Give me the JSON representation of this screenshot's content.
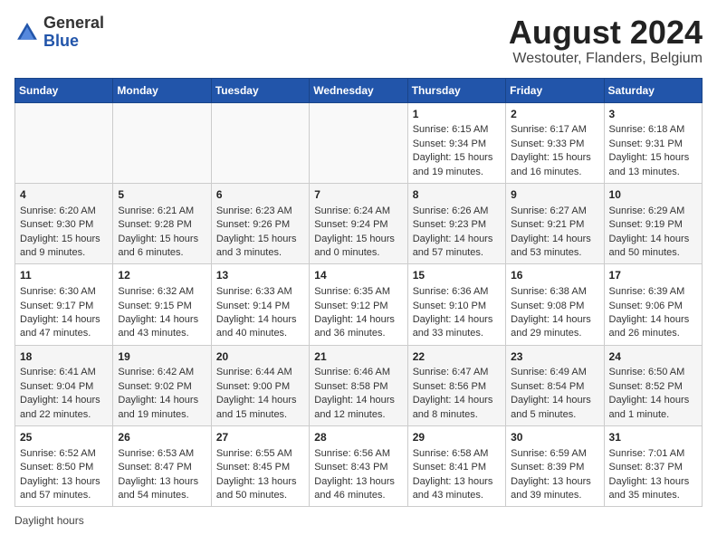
{
  "logo": {
    "general": "General",
    "blue": "Blue"
  },
  "title": "August 2024",
  "subtitle": "Westouter, Flanders, Belgium",
  "days_of_week": [
    "Sunday",
    "Monday",
    "Tuesday",
    "Wednesday",
    "Thursday",
    "Friday",
    "Saturday"
  ],
  "footer": "Daylight hours",
  "weeks": [
    [
      {
        "day": "",
        "content": ""
      },
      {
        "day": "",
        "content": ""
      },
      {
        "day": "",
        "content": ""
      },
      {
        "day": "",
        "content": ""
      },
      {
        "day": "1",
        "content": "Sunrise: 6:15 AM\nSunset: 9:34 PM\nDaylight: 15 hours\nand 19 minutes."
      },
      {
        "day": "2",
        "content": "Sunrise: 6:17 AM\nSunset: 9:33 PM\nDaylight: 15 hours\nand 16 minutes."
      },
      {
        "day": "3",
        "content": "Sunrise: 6:18 AM\nSunset: 9:31 PM\nDaylight: 15 hours\nand 13 minutes."
      }
    ],
    [
      {
        "day": "4",
        "content": "Sunrise: 6:20 AM\nSunset: 9:30 PM\nDaylight: 15 hours\nand 9 minutes."
      },
      {
        "day": "5",
        "content": "Sunrise: 6:21 AM\nSunset: 9:28 PM\nDaylight: 15 hours\nand 6 minutes."
      },
      {
        "day": "6",
        "content": "Sunrise: 6:23 AM\nSunset: 9:26 PM\nDaylight: 15 hours\nand 3 minutes."
      },
      {
        "day": "7",
        "content": "Sunrise: 6:24 AM\nSunset: 9:24 PM\nDaylight: 15 hours\nand 0 minutes."
      },
      {
        "day": "8",
        "content": "Sunrise: 6:26 AM\nSunset: 9:23 PM\nDaylight: 14 hours\nand 57 minutes."
      },
      {
        "day": "9",
        "content": "Sunrise: 6:27 AM\nSunset: 9:21 PM\nDaylight: 14 hours\nand 53 minutes."
      },
      {
        "day": "10",
        "content": "Sunrise: 6:29 AM\nSunset: 9:19 PM\nDaylight: 14 hours\nand 50 minutes."
      }
    ],
    [
      {
        "day": "11",
        "content": "Sunrise: 6:30 AM\nSunset: 9:17 PM\nDaylight: 14 hours\nand 47 minutes."
      },
      {
        "day": "12",
        "content": "Sunrise: 6:32 AM\nSunset: 9:15 PM\nDaylight: 14 hours\nand 43 minutes."
      },
      {
        "day": "13",
        "content": "Sunrise: 6:33 AM\nSunset: 9:14 PM\nDaylight: 14 hours\nand 40 minutes."
      },
      {
        "day": "14",
        "content": "Sunrise: 6:35 AM\nSunset: 9:12 PM\nDaylight: 14 hours\nand 36 minutes."
      },
      {
        "day": "15",
        "content": "Sunrise: 6:36 AM\nSunset: 9:10 PM\nDaylight: 14 hours\nand 33 minutes."
      },
      {
        "day": "16",
        "content": "Sunrise: 6:38 AM\nSunset: 9:08 PM\nDaylight: 14 hours\nand 29 minutes."
      },
      {
        "day": "17",
        "content": "Sunrise: 6:39 AM\nSunset: 9:06 PM\nDaylight: 14 hours\nand 26 minutes."
      }
    ],
    [
      {
        "day": "18",
        "content": "Sunrise: 6:41 AM\nSunset: 9:04 PM\nDaylight: 14 hours\nand 22 minutes."
      },
      {
        "day": "19",
        "content": "Sunrise: 6:42 AM\nSunset: 9:02 PM\nDaylight: 14 hours\nand 19 minutes."
      },
      {
        "day": "20",
        "content": "Sunrise: 6:44 AM\nSunset: 9:00 PM\nDaylight: 14 hours\nand 15 minutes."
      },
      {
        "day": "21",
        "content": "Sunrise: 6:46 AM\nSunset: 8:58 PM\nDaylight: 14 hours\nand 12 minutes."
      },
      {
        "day": "22",
        "content": "Sunrise: 6:47 AM\nSunset: 8:56 PM\nDaylight: 14 hours\nand 8 minutes."
      },
      {
        "day": "23",
        "content": "Sunrise: 6:49 AM\nSunset: 8:54 PM\nDaylight: 14 hours\nand 5 minutes."
      },
      {
        "day": "24",
        "content": "Sunrise: 6:50 AM\nSunset: 8:52 PM\nDaylight: 14 hours\nand 1 minute."
      }
    ],
    [
      {
        "day": "25",
        "content": "Sunrise: 6:52 AM\nSunset: 8:50 PM\nDaylight: 13 hours\nand 57 minutes."
      },
      {
        "day": "26",
        "content": "Sunrise: 6:53 AM\nSunset: 8:47 PM\nDaylight: 13 hours\nand 54 minutes."
      },
      {
        "day": "27",
        "content": "Sunrise: 6:55 AM\nSunset: 8:45 PM\nDaylight: 13 hours\nand 50 minutes."
      },
      {
        "day": "28",
        "content": "Sunrise: 6:56 AM\nSunset: 8:43 PM\nDaylight: 13 hours\nand 46 minutes."
      },
      {
        "day": "29",
        "content": "Sunrise: 6:58 AM\nSunset: 8:41 PM\nDaylight: 13 hours\nand 43 minutes."
      },
      {
        "day": "30",
        "content": "Sunrise: 6:59 AM\nSunset: 8:39 PM\nDaylight: 13 hours\nand 39 minutes."
      },
      {
        "day": "31",
        "content": "Sunrise: 7:01 AM\nSunset: 8:37 PM\nDaylight: 13 hours\nand 35 minutes."
      }
    ]
  ]
}
